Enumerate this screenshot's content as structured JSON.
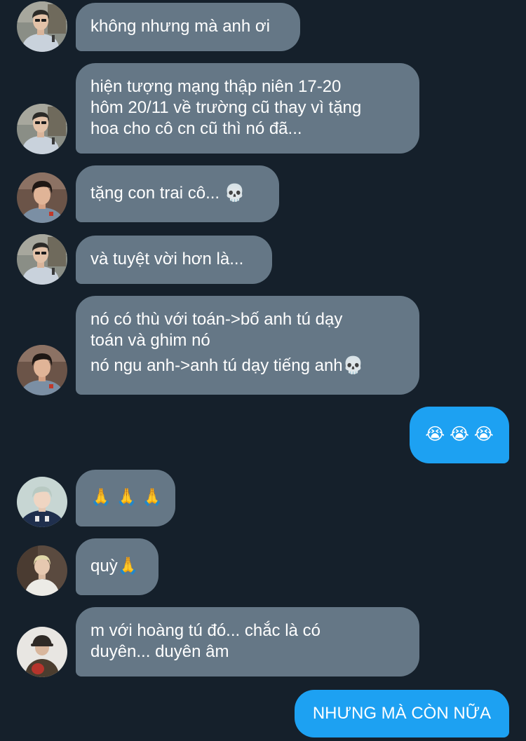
{
  "messages": [
    {
      "sender": "other",
      "avatar": "user-a",
      "lines": [
        "không nhưng mà anh ơi"
      ]
    },
    {
      "sender": "other",
      "avatar": "user-a",
      "lines": [
        "hiện tượng mạng thập niên 17-20",
        "hôm 20/11 về trường cũ thay vì tặng",
        "hoa cho cô cn cũ thì nó đã..."
      ]
    },
    {
      "sender": "other",
      "avatar": "user-b",
      "lines": [
        "tặng con trai cô... 💀"
      ]
    },
    {
      "sender": "other",
      "avatar": "user-a",
      "lines": [
        "và tuyệt vời hơn là..."
      ]
    },
    {
      "sender": "other",
      "avatar": "user-b",
      "lines": [
        "nó có thù với toán->bố anh tú dạy",
        "toán và ghim nó",
        "nó ngu anh->anh tú dạy tiếng anh💀"
      ]
    },
    {
      "sender": "self",
      "lines": [
        "😭 😭 😭"
      ]
    },
    {
      "sender": "other",
      "avatar": "user-c",
      "lines": [
        "🙏 🙏 🙏"
      ]
    },
    {
      "sender": "other",
      "avatar": "user-d",
      "lines": [
        "quỳ🙏"
      ]
    },
    {
      "sender": "other",
      "avatar": "user-e",
      "lines": [
        "m với hoàng tú đó... chắc là có",
        "duyên... duyên âm"
      ]
    },
    {
      "sender": "self",
      "lines": [
        "NHƯNG MÀ CÒN NỮA"
      ]
    }
  ],
  "colors": {
    "background": "#15202b",
    "incoming_bubble": "#657786",
    "outgoing_bubble": "#1da1f2",
    "text": "#ffffff"
  }
}
